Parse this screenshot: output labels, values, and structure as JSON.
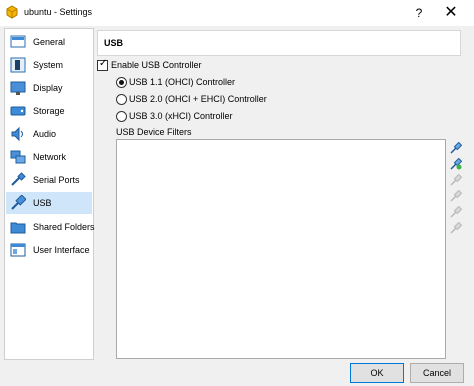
{
  "window": {
    "title": "ubuntu - Settings",
    "help_glyph": "?",
    "close_glyph": "✕",
    "icon": "virtualbox-app-icon"
  },
  "sidebar": {
    "items": [
      {
        "label": "General",
        "icon": "general-icon"
      },
      {
        "label": "System",
        "icon": "system-icon"
      },
      {
        "label": "Display",
        "icon": "display-icon"
      },
      {
        "label": "Storage",
        "icon": "storage-icon"
      },
      {
        "label": "Audio",
        "icon": "audio-icon"
      },
      {
        "label": "Network",
        "icon": "network-icon"
      },
      {
        "label": "Serial Ports",
        "icon": "serial-ports-icon"
      },
      {
        "label": "USB",
        "icon": "usb-icon",
        "selected": true
      },
      {
        "label": "Shared Folders",
        "icon": "shared-folders-icon"
      },
      {
        "label": "User Interface",
        "icon": "user-interface-icon"
      }
    ]
  },
  "main": {
    "header": "USB",
    "enable_usb": {
      "label": "Enable USB Controller",
      "checked": true
    },
    "controllers": [
      {
        "label": "USB 1.1 (OHCI) Controller",
        "selected": true
      },
      {
        "label": "USB 2.0 (OHCI + EHCI) Controller",
        "selected": false
      },
      {
        "label": "USB 3.0 (xHCI) Controller",
        "selected": false
      }
    ],
    "filters_label": "USB Device Filters",
    "filter_tools": [
      "add-empty-filter-icon",
      "add-filter-from-device-icon",
      "edit-filter-icon",
      "remove-filter-icon",
      "move-up-icon",
      "move-down-icon"
    ]
  },
  "buttons": {
    "ok": "OK",
    "cancel": "Cancel"
  },
  "colors": {
    "selection": "#cfe6fa",
    "accent": "#0078d7"
  }
}
